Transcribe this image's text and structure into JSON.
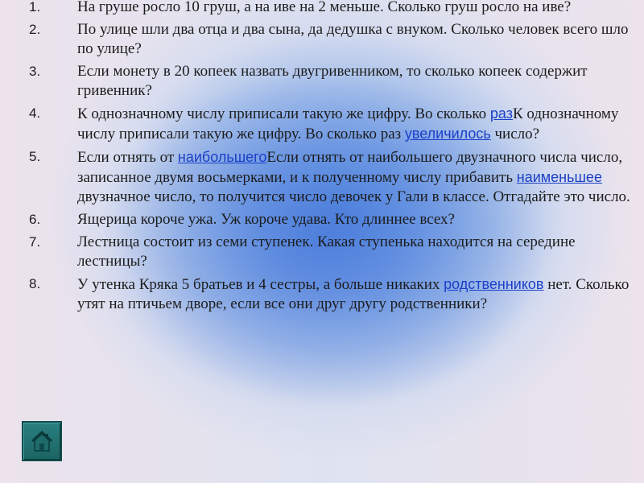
{
  "tasks": [
    {
      "num": "1.",
      "text": "На груше росло 10 груш, а на иве на 2 меньше. Сколько груш росло на иве?"
    },
    {
      "num": "2.",
      "text": " По улице шли два отца и два сына, да дедушка с внуком. Сколько человек всего шло по улице?"
    },
    {
      "num": "3.",
      "text": "Если монету в 20 копеек назвать двугривенником, то сколько копеек содержит гривенник?"
    },
    {
      "num": "4.",
      "part1": "К однозначному числу приписали такую же цифру. Во сколько ",
      "link1": "раз",
      "part2": "К однозначному числу приписали такую же цифру. Во сколько раз ",
      "link2": "увеличилось",
      "part3": " число?"
    },
    {
      "num": "5.",
      "part1": "Если отнять от ",
      "link1": "наибольшего",
      "part2": "Если отнять от наибольшего двузначного числа число, записанное двумя восьмерками, и к полученному числу прибавить ",
      "link2": "наименьшее",
      "part3": " двузначное число, то получится число девочек у Гали в классе. Отгадайте это число."
    },
    {
      "num": "6.",
      "text": "Ящерица короче ужа. Уж короче удава. Кто длиннее всех?"
    },
    {
      "num": "7.",
      "text": "Лестница состоит из семи ступенек. Какая ступенька находится на середине лестницы?"
    },
    {
      "num": "8.",
      "part1": "У утенка Кряка 5 братьев и 4 сестры, а больше никаких ",
      "link1": "родственников",
      "part2": " нет. Сколько утят на птичьем дворе, если все они друг другу родственники?"
    }
  ],
  "home_button": {
    "icon": "home-icon",
    "color": "#1c6464"
  }
}
